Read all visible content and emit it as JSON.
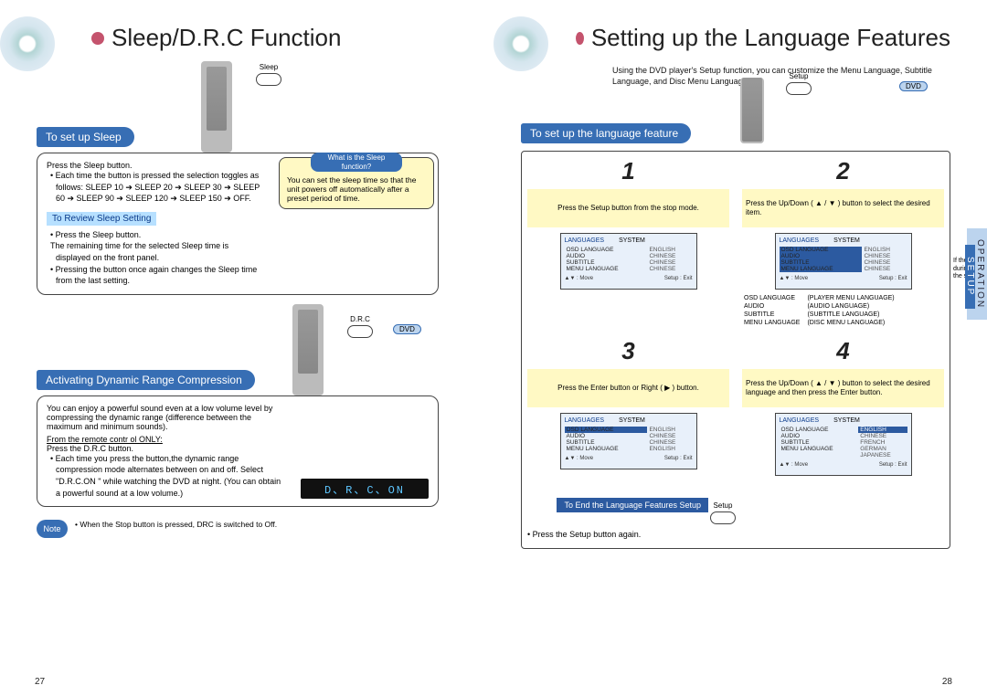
{
  "left": {
    "title": "Sleep/D.R.C Function",
    "sleep": {
      "heading": "To set up Sleep",
      "remote_btn": "Sleep",
      "press": "Press the Sleep button.",
      "bullet1": "Each time the button is pressed the selection toggles as follows: SLEEP 10 ➔ SLEEP 20 ➔ SLEEP 30 ➔ SLEEP 60 ➔ SLEEP 90 ➔ SLEEP 120 ➔ SLEEP 150 ➔ OFF.",
      "callout_q": "What is the Sleep function?",
      "callout_a": "You can set the sleep time so that the unit powers off automatically after a preset period of time.",
      "review_head": "To Review Sleep Setting",
      "review_b1": "Press the Sleep button.",
      "review_line": "The remaining time for the selected Sleep time is displayed on the front panel.",
      "review_b2": "Pressing the button once again changes the Sleep time from the last setting."
    },
    "drc": {
      "heading": "Activating Dynamic Range Compression",
      "remote_btn": "D.R.C",
      "dvd": "DVD",
      "desc": "You can enjoy a powerful sound even at a low volume level by compressing the dynamic range (difference between the maximum and minimum sounds).",
      "from": "From the remote contr ol ONLY:",
      "press": "Press the D.R.C button.",
      "bullet": "Each time you press the button,the dynamic range compression mode alternates between on and off. Select \"D.R.C.ON \" while watching the DVD at night. (You can obtain a powerful sound at a low volume.)",
      "display": "D、R、C、ON",
      "note_label": "Note",
      "note": "When the Stop button is pressed, DRC is switched to Off."
    },
    "pagenum": "27"
  },
  "right": {
    "title": "Setting up the Language Features",
    "intro": "Using the DVD player's Setup function, you can customize the Menu Language, Subtitle Language, and Disc Menu Language.",
    "heading": "To set up the language feature",
    "remote_btn": "Setup",
    "dvd": "DVD",
    "tab1": "OPERATION",
    "tab2": "SETUP",
    "steps": {
      "s1": {
        "num": "1",
        "text": "Press the Setup button from the stop mode."
      },
      "s2": {
        "num": "2",
        "text": "Press the Up/Down ( ▲ / ▼ ) button to select the desired item."
      },
      "s3": {
        "num": "3",
        "text": "Press the Enter button or Right ( ▶ ) button."
      },
      "s4": {
        "num": "4",
        "text": "Press the Up/Down ( ▲ / ▼ ) button to select the desired language and then press the Enter button."
      }
    },
    "osd": {
      "tab_lang": "LANGUAGES",
      "tab_sys": "SYSTEM",
      "rows": [
        {
          "k": "OSD LANGUAGE",
          "v": "ENGLISH"
        },
        {
          "k": "AUDIO",
          "v": "CHINESE"
        },
        {
          "k": "SUBTITLE",
          "v": "CHINESE"
        },
        {
          "k": "MENU LANGUAGE",
          "v": "CHINESE"
        }
      ],
      "foot_move": "Move",
      "foot_exit": "Setup : Exit"
    },
    "legend": [
      {
        "k": "OSD LANGUAGE",
        "v": "(PLAYER MENU LANGUAGE)"
      },
      {
        "k": "AUDIO",
        "v": "(AUDIO LANGUAGE)"
      },
      {
        "k": "SUBTITLE",
        "v": "(SUBTITLE LANGUAGE)"
      },
      {
        "k": "MENU LANGUAGE",
        "v": "(DISC MENU LANGUAGE)"
      }
    ],
    "osd3_rows": [
      {
        "k": "OSD LANGUAGE",
        "v": "ENGLISH",
        "hl": true
      },
      {
        "k": "AUDIO",
        "v": "CHINESE"
      },
      {
        "k": "SUBTITLE",
        "v": "CHINESE"
      },
      {
        "k": "MENU LANGUAGE",
        "v": "ENGLISH"
      }
    ],
    "osd4_rows": [
      {
        "k": "OSD LANGUAGE",
        "v": "ENGLISH",
        "hlv": true
      },
      {
        "k": "AUDIO",
        "v": "CHINESE"
      },
      {
        "k": "SUBTITLE",
        "v": "FRENCH"
      },
      {
        "k": "MENU LANGUAGE",
        "v": "GERMAN"
      }
    ],
    "osd4_extra": "JAPANESE",
    "step2_note": "If the Setup/P.Adj button is pressed during the language setup, it returns to the stop mode again.",
    "end_heading": "To End the Language Features Setup",
    "end_btn": "Setup",
    "end_text": "Press the Setup button again.",
    "pagenum": "28"
  }
}
